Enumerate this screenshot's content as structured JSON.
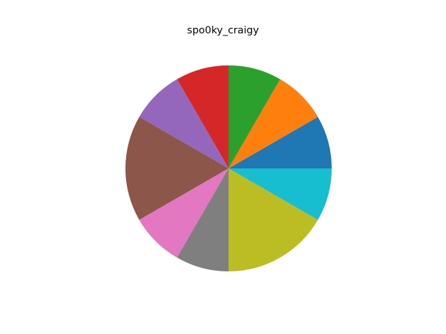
{
  "chart_data": {
    "type": "pie",
    "title": "spo0ky_craigy",
    "labels": [],
    "values": [
      1,
      1,
      1,
      1,
      1,
      2,
      1,
      1,
      2,
      1
    ],
    "colors": [
      "#1f77b4",
      "#ff7f0e",
      "#2ca02c",
      "#d62728",
      "#9467bd",
      "#8c564b",
      "#e377c2",
      "#7f7f7f",
      "#bcbd22",
      "#17becf"
    ],
    "start_angle_deg": 0,
    "direction": "counterclockwise",
    "legend": "none"
  }
}
